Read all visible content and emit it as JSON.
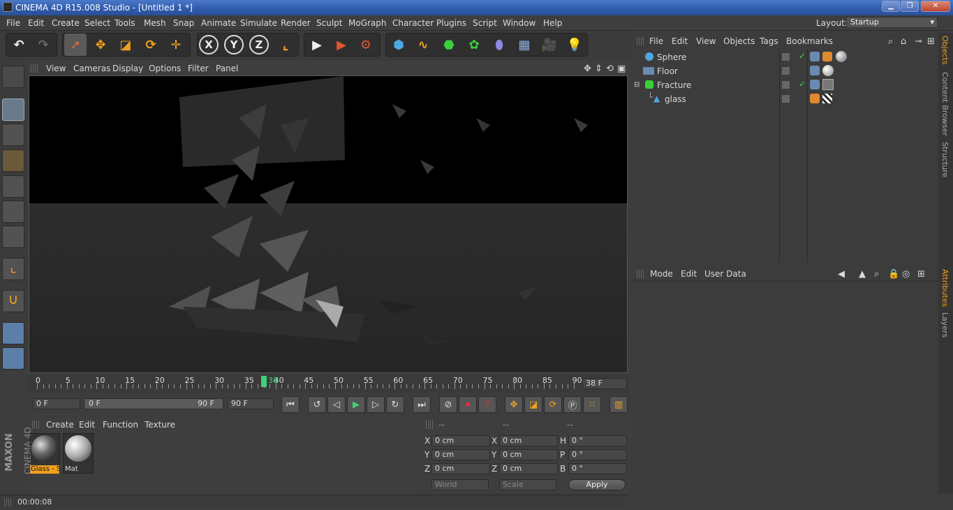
{
  "window": {
    "title": "CINEMA 4D R15.008 Studio - [Untitled 1 *]"
  },
  "menu": [
    "File",
    "Edit",
    "Create",
    "Select",
    "Tools",
    "Mesh",
    "Snap",
    "Animate",
    "Simulate",
    "Render",
    "Sculpt",
    "MoGraph",
    "Character",
    "Plugins",
    "Script",
    "Window",
    "Help"
  ],
  "layout": {
    "label": "Layout:",
    "value": "Startup"
  },
  "viewport": {
    "menu": [
      "View",
      "Cameras",
      "Display",
      "Options",
      "Filter",
      "Panel"
    ]
  },
  "timeline": {
    "ticks": [
      "0",
      "5",
      "10",
      "15",
      "20",
      "25",
      "30",
      "35",
      "40",
      "45",
      "50",
      "55",
      "60",
      "65",
      "70",
      "75",
      "80",
      "85",
      "90"
    ],
    "current_frame": "38",
    "frame_field": "38 F",
    "start_field": "0 F",
    "range_start": "0 F",
    "range_end": "90 F",
    "end_field": "90 F"
  },
  "materials": {
    "menu": [
      "Create",
      "Edit",
      "Function",
      "Texture"
    ],
    "items": [
      {
        "name": "Glass - S"
      },
      {
        "name": "Mat"
      }
    ]
  },
  "coords": {
    "headers": [
      "--",
      "--",
      "--"
    ],
    "rows": [
      {
        "a": "X",
        "av": "0 cm",
        "b": "X",
        "bv": "0 cm",
        "c": "H",
        "cv": "0 °"
      },
      {
        "a": "Y",
        "av": "0 cm",
        "b": "Y",
        "bv": "0 cm",
        "c": "P",
        "cv": "0 °"
      },
      {
        "a": "Z",
        "av": "0 cm",
        "b": "Z",
        "bv": "0 cm",
        "c": "B",
        "cv": "0 °"
      }
    ],
    "mode1": "World",
    "mode2": "Scale",
    "apply": "Apply"
  },
  "status": {
    "time": "00:00:08"
  },
  "objects": {
    "menu": [
      "File",
      "Edit",
      "View",
      "Objects",
      "Tags",
      "Bookmarks"
    ],
    "items": [
      {
        "name": "Sphere"
      },
      {
        "name": "Floor"
      },
      {
        "name": "Fracture"
      },
      {
        "name": "glass"
      }
    ]
  },
  "attributes": {
    "menu": [
      "Mode",
      "Edit",
      "User Data"
    ]
  },
  "side_tabs": [
    "Objects",
    "Content Browser",
    "Structure",
    "Attributes",
    "Layers"
  ],
  "brand": {
    "line1": "MAXON",
    "line2": "CINEMA 4D"
  },
  "colors": {
    "accent": "#f0a020",
    "timeline_marker": "#3fd07a",
    "active_tool": "#5b8fd0"
  }
}
